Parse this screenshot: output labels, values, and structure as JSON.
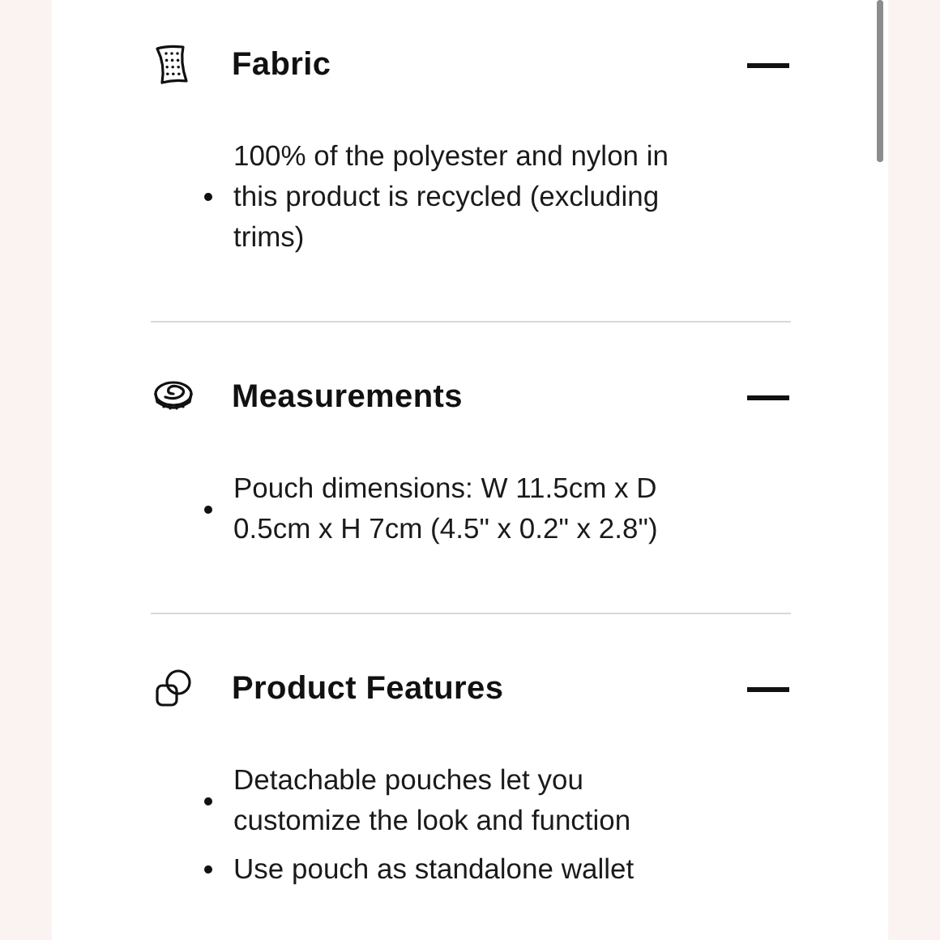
{
  "sections": [
    {
      "kind": "fabric",
      "title": "Fabric",
      "expanded": true,
      "items": [
        "100% of the polyester and nylon in this product is recycled (excluding trims)"
      ]
    },
    {
      "kind": "measurements",
      "title": "Measurements",
      "expanded": true,
      "items": [
        "Pouch dimensions: W 11.5cm x D 0.5cm x H 7cm (4.5\" x 0.2\" x 2.8\")"
      ]
    },
    {
      "kind": "features",
      "title": "Product Features",
      "expanded": true,
      "items": [
        "Detachable pouches let you customize the look and function",
        "Use pouch as standalone wallet"
      ]
    }
  ]
}
